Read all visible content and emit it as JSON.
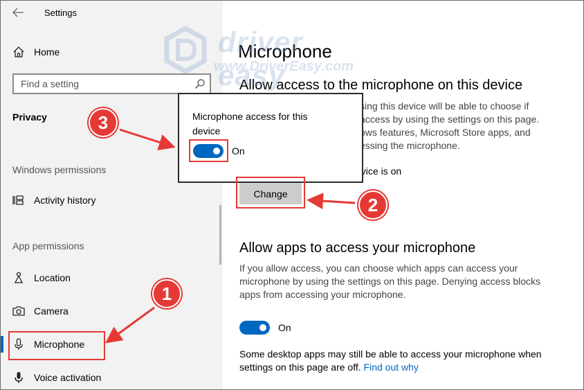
{
  "window": {
    "title": "Settings"
  },
  "sidebar": {
    "home_label": "Home",
    "search_placeholder": "Find a setting",
    "section_title": "Privacy",
    "windows_permissions_header": "Windows permissions",
    "activity_history_label": "Activity history",
    "app_permissions_header": "App permissions",
    "items": [
      {
        "label": "Location",
        "icon": "location-icon"
      },
      {
        "label": "Camera",
        "icon": "camera-icon"
      },
      {
        "label": "Microphone",
        "icon": "microphone-icon",
        "active": true
      },
      {
        "label": "Voice activation",
        "icon": "voice-activation-icon"
      }
    ]
  },
  "main": {
    "page_title": "Microphone",
    "device_access_heading": "Allow access to the microphone on this device",
    "device_access_text": "sing this device will be able to choose if access by using the settings on this page. ows features, Microsoft Store apps, and essing the microphone.",
    "device_access_status": "evice is on",
    "change_button": "Change",
    "apps_access_heading": "Allow apps to access your microphone",
    "apps_access_text": "If you allow access, you can choose which apps can access your microphone by using the settings on this page. Denying access blocks apps from accessing your microphone.",
    "apps_toggle_label": "On",
    "apps_toggle_on": true,
    "desktop_note": "Some desktop apps may still be able to access your microphone when settings on this page are off.",
    "find_out_link": "Find out why"
  },
  "popup": {
    "title": "Microphone access for this device",
    "toggle_label": "On",
    "toggle_on": true
  },
  "watermark": {
    "brand": "driver easy",
    "url": "www.DriverEasy.com"
  },
  "callouts": {
    "step1": "1",
    "step2": "2",
    "step3": "3"
  },
  "colors": {
    "accent": "#0067c0",
    "callout": "#e53935",
    "sidebar_bg": "#f2f2f2"
  }
}
